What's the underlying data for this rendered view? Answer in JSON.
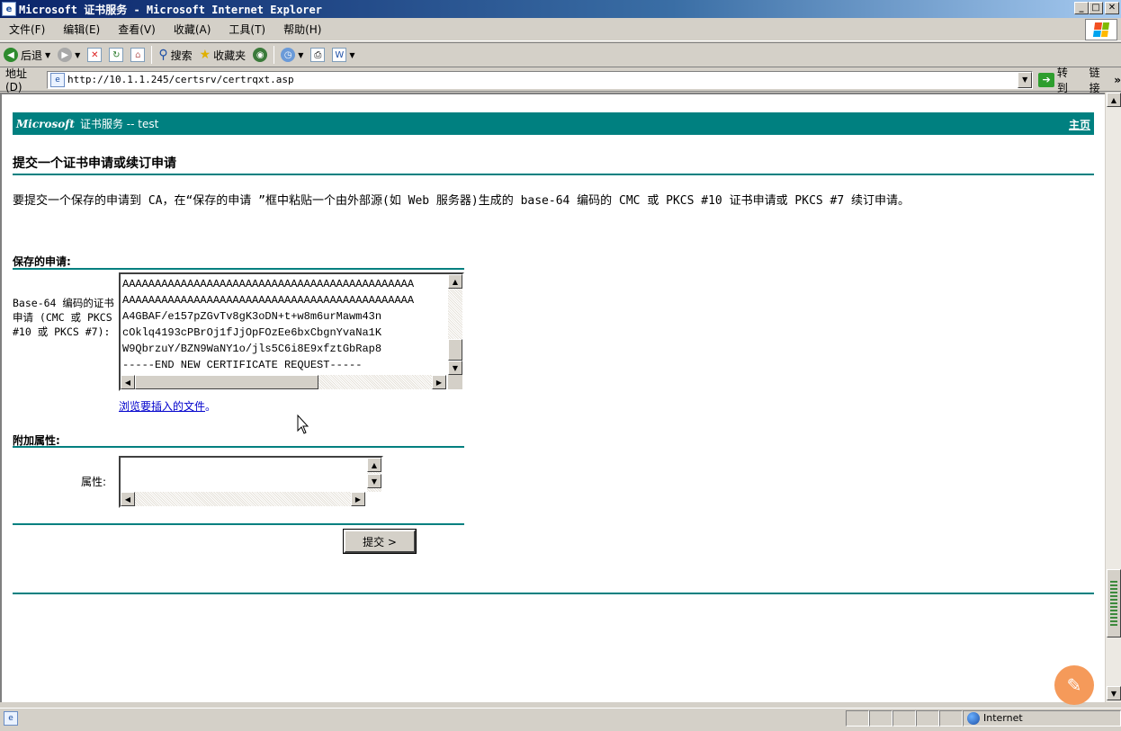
{
  "window": {
    "title": "Microsoft 证书服务 - Microsoft Internet Explorer",
    "controls": [
      "_",
      "□",
      "✕"
    ]
  },
  "menu": [
    "文件(F)",
    "编辑(E)",
    "查看(V)",
    "收藏(A)",
    "工具(T)",
    "帮助(H)"
  ],
  "toolbar": {
    "back_label": "后退",
    "search_label": "搜索",
    "favorites_label": "收藏夹"
  },
  "address": {
    "label": "地址(D)",
    "url": "http://10.1.1.245/certsrv/certrqxt.asp",
    "go_label": "转到",
    "links_label": "链接",
    "more": "»"
  },
  "page": {
    "brand": "Microsoft",
    "service_title": "证书服务 -- test",
    "home_link": "主页",
    "heading": "提交一个证书申请或续订申请",
    "description": "要提交一个保存的申请到 CA，在“保存的申请 ”框中粘贴一个由外部源(如 Web 服务器)生成的 base-64 编码的 CMC 或 PKCS #10 证书申请或 PKCS #7 续订申请。",
    "saved_request_section": "保存的申请:",
    "request_field_label": "Base-64 编码的证书申请 (CMC 或 PKCS #10 或 PKCS #7):",
    "request_lines": [
      "AAAAAAAAAAAAAAAAAAAAAAAAAAAAAAAAAAAAAAAAAAAAA",
      "AAAAAAAAAAAAAAAAAAAAAAAAAAAAAAAAAAAAAAAAAAAAA",
      "A4GBAF/e157pZGvTv8gK3oDN+t+w8m6urMawm43n",
      "cOklq4193cPBrOj1fJjOpFOzEe6bxCbgnYvaNa1K",
      "W9QbrzuY/BZN9WaNY1o/jls5C6i8E9xfztGbRap8",
      "-----END NEW CERTIFICATE REQUEST-----"
    ],
    "browse_link": "浏览要插入的文件",
    "browse_suffix": "。",
    "additional_section": "附加属性:",
    "attributes_label": "属性:",
    "attributes_value": "",
    "submit_label": "提交 >"
  },
  "status": {
    "zone": "Internet"
  },
  "colors": {
    "accent": "#008080",
    "titlebar": "#0a246a",
    "chrome": "#d4d0c8"
  }
}
